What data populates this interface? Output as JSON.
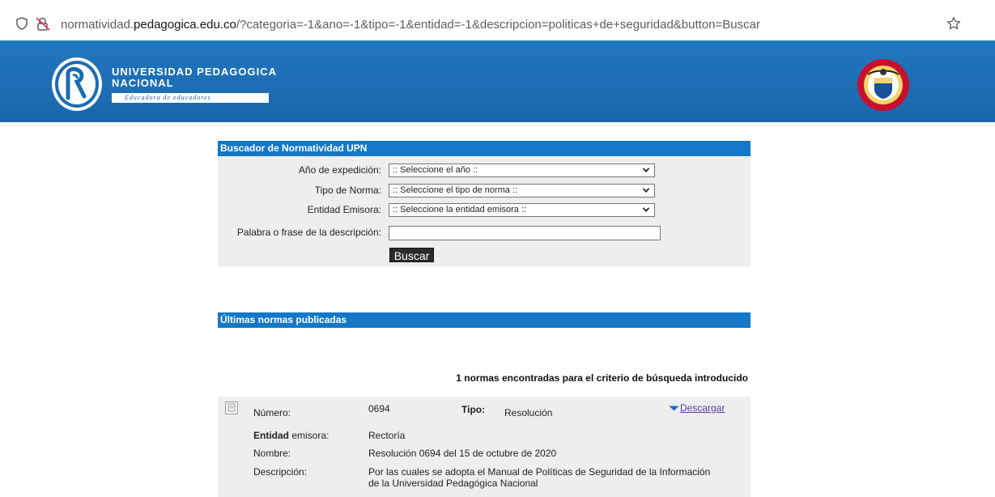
{
  "browser": {
    "url_prefix": "normatividad.",
    "url_host": "pedagogica.edu.co",
    "url_rest": "/?categoria=-1&ano=-1&tipo=-1&entidad=-1&descripcion=politicas+de+seguridad&button=Buscar"
  },
  "header": {
    "university_line1": "UNIVERSIDAD PEDAGOGICA",
    "university_line2": "NACIONAL",
    "motto": "Educadora de educadores"
  },
  "search_panel": {
    "title": "Buscador de Normatividad UPN",
    "year_label": "Año de expedición:",
    "year_value": ":: Seleccione el año ::",
    "type_label": "Tipo de Norma:",
    "type_value": ":: Seleccione el tipo de norma ::",
    "entity_label": "Entidad Emisora:",
    "entity_value": ":: Seleccione la entidad emisora ::",
    "phrase_label": "Palabra o frase de la descripción:",
    "phrase_value": "",
    "search_button": "Buscar"
  },
  "latest": {
    "title": "Últimas normas publicadas",
    "count_text": "1 normas encontradas para el criterio de búsqueda introducido"
  },
  "result": {
    "numero_label": "Número:",
    "numero_value": "0694",
    "tipo_label": "Tipo:",
    "tipo_value": "Resolución",
    "download_label": " Descargar",
    "entidad_label_bold": "Entidad",
    "entidad_label_rest": " emisora:",
    "entidad_value": "Rectoría",
    "nombre_label": "Nombre:",
    "nombre_value": "Resolución 0694 del 15 de octubre de 2020",
    "descripcion_label": "Descripción:",
    "descripcion_line1": "Por las cuales se adopta el Manual de Políticas de Seguridad de la Información",
    "descripcion_line2": "de la Universidad Pedagógica Nacional"
  },
  "colors": {
    "banner_blue": "#1a6cb2",
    "panel_header_blue": "#1477c7",
    "panel_bg": "#eeeeee",
    "link_purple": "#5a3b9c"
  }
}
